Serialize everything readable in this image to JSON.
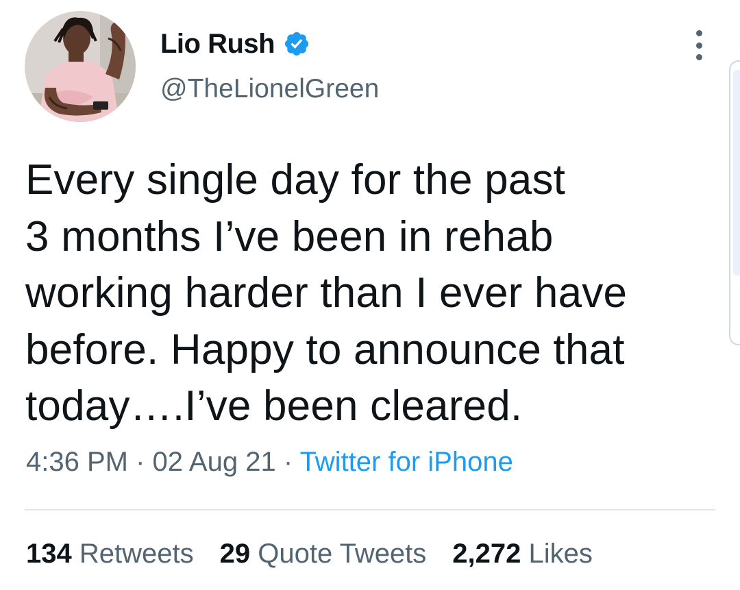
{
  "tweet": {
    "author": {
      "display_name": "Lio Rush",
      "handle": "@TheLionelGreen",
      "verified": true,
      "verified_icon": "verified-badge-icon",
      "verified_color": "#1d9bf0"
    },
    "text_lines": [
      "Every single day for the past",
      "3 months I’ve been in rehab",
      "working harder than I ever have",
      "before. Happy to announce that",
      "today….I’ve been cleared."
    ],
    "time": "4:36 PM",
    "separator": "·",
    "date": "02 Aug 21",
    "source": "Twitter for iPhone",
    "source_color": "#1d9bf0",
    "stats": {
      "retweets": {
        "count": "134",
        "label": "Retweets"
      },
      "quote_tweets": {
        "count": "29",
        "label": "Quote Tweets"
      },
      "likes": {
        "count": "2,272",
        "label": "Likes"
      }
    },
    "more_icon": "more-options-icon"
  }
}
